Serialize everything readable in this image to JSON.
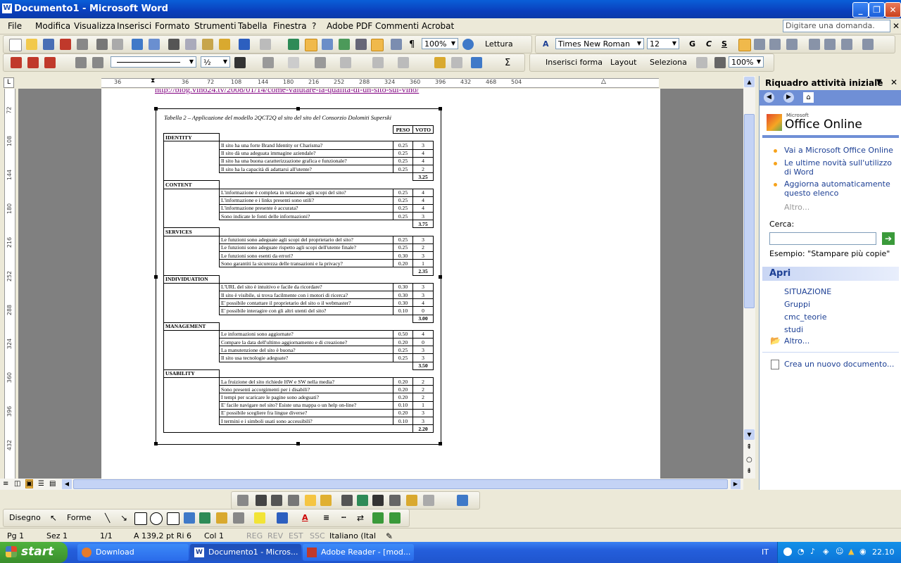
{
  "window": {
    "title": "Documento1 - Microsoft Word",
    "app_icon": "W"
  },
  "menu": {
    "items": [
      "File",
      "Modifica",
      "Visualizza",
      "Inserisci",
      "Formato",
      "Strumenti",
      "Tabella",
      "Finestra",
      "?",
      "Adobe PDF",
      "Commenti Acrobat"
    ],
    "ask_placeholder": "Digitare una domanda."
  },
  "toolbar_standard": {
    "zoom": "100%",
    "reading_label": "Lettura",
    "font": "Times New Roman",
    "size": "12",
    "bold": "G",
    "italic": "C",
    "underline": "S"
  },
  "toolbar_second": {
    "line_weight": "½",
    "insert_shape": "Inserisci forma",
    "layout": "Layout",
    "select": "Seleziona",
    "zoom": "100%"
  },
  "ruler": {
    "marks": [
      "36",
      "36",
      "72",
      "108",
      "144",
      "180",
      "216",
      "252",
      "288",
      "324",
      "360",
      "396",
      "432",
      "468",
      "504"
    ],
    "vmarks": [
      "72",
      "108",
      "144",
      "180",
      "216",
      "252",
      "288",
      "324",
      "360",
      "396",
      "432"
    ]
  },
  "document": {
    "link_text": "http://blog.vino24.tv/2008/01/14/come-valutare-la-qualita-di-un-sito-sul-vino/",
    "table_title": "Tabella 2 – Applicazione del modello 2QCT2Q al sito del sito del Consorzio Dolomiti Superski",
    "headers": {
      "peso": "PESO",
      "voto": "VOTO"
    },
    "sections": [
      {
        "name": "IDENTITY",
        "total": "3.25",
        "rows": [
          {
            "q": "Il sito ha una forte Brand Identity or Charisma?",
            "peso": "0.25",
            "voto": "3"
          },
          {
            "q": "Il sito dà una adeguata immagine aziendale?",
            "peso": "0.25",
            "voto": "4"
          },
          {
            "q": "Il sito ha una buona caratterizzazione grafica e funzionale?",
            "peso": "0.25",
            "voto": "4"
          },
          {
            "q": "Il sito ha la capacità di adattarsi all'utente?",
            "peso": "0.25",
            "voto": "2"
          }
        ]
      },
      {
        "name": "CONTENT",
        "total": "3.75",
        "rows": [
          {
            "q": "L'informazione è completa in relazione agli scopi del sito?",
            "peso": "0.25",
            "voto": "4"
          },
          {
            "q": "L'informazione e i links presenti sono utili?",
            "peso": "0.25",
            "voto": "4"
          },
          {
            "q": "L'informazione presente è accurata?",
            "peso": "0.25",
            "voto": "4"
          },
          {
            "q": "Sono indicate le fonti delle informazioni?",
            "peso": "0.25",
            "voto": "3"
          }
        ]
      },
      {
        "name": "SERVICES",
        "total": "2.35",
        "rows": [
          {
            "q": "Le funzioni sono adeguate agli scopi del proprietario del sito?",
            "peso": "0.25",
            "voto": "3"
          },
          {
            "q": "Le funzioni sono adeguate rispetto agli scopi dell'utente finale?",
            "peso": "0.25",
            "voto": "2"
          },
          {
            "q": "Le funzioni sono esenti da errori?",
            "peso": "0.30",
            "voto": "3"
          },
          {
            "q": "Sono garantiti la sicurezza delle transazioni e la privacy?",
            "peso": "0.20",
            "voto": "1"
          }
        ]
      },
      {
        "name": "INDIVIDUATION",
        "total": "3.00",
        "rows": [
          {
            "q": "L'URL del sito è intuitivo e facile da ricordare?",
            "peso": "0.30",
            "voto": "3"
          },
          {
            "q": "Il sito è visibile, si trova facilmente con i motori di ricerca?",
            "peso": "0.30",
            "voto": "3"
          },
          {
            "q": "E' possibile contattare il proprietario del sito o il webmaster?",
            "peso": "0.30",
            "voto": "4"
          },
          {
            "q": "E' possibile interagire con gli altri utenti del sito?",
            "peso": "0.10",
            "voto": "0"
          }
        ]
      },
      {
        "name": "MANAGEMENT",
        "total": "3.50",
        "rows": [
          {
            "q": "Le informazioni sono aggiornate?",
            "peso": "0.50",
            "voto": "4"
          },
          {
            "q": "Compare la data dell'ultimo aggiornamento e di creazione?",
            "peso": "0.20",
            "voto": "0"
          },
          {
            "q": "La manutenzione del sito è buona?",
            "peso": "0.25",
            "voto": "3"
          },
          {
            "q": "Il sito usa tecnologie adeguate?",
            "peso": "0.25",
            "voto": "3"
          }
        ]
      },
      {
        "name": "USABILITY",
        "total": "2.20",
        "rows": [
          {
            "q": "La fruizione del sito richiede HW e SW nella media?",
            "peso": "0.20",
            "voto": "2"
          },
          {
            "q": "Sono presenti accorgimenti per i disabili?",
            "peso": "0.20",
            "voto": "2"
          },
          {
            "q": "I tempi per scaricare le pagine sono adeguati?",
            "peso": "0.20",
            "voto": "2"
          },
          {
            "q": "E' facile navigare nel sito? Esiste una mappa o un help on-line?",
            "peso": "0.10",
            "voto": "1"
          },
          {
            "q": "E' possibile scegliere fra lingue diverse?",
            "peso": "0.20",
            "voto": "3"
          },
          {
            "q": "I termini e i simboli usati sono accessibili?",
            "peso": "0.10",
            "voto": "3"
          }
        ]
      }
    ]
  },
  "taskpane": {
    "title": "Riquadro attività iniziale",
    "logo_small": "Microsoft",
    "logo": "Office Online",
    "links": [
      "Vai a Microsoft Office Online",
      "Le ultime novità sull'utilizzo di Word",
      "Aggiorna automaticamente questo elenco"
    ],
    "more": "Altro...",
    "search_label": "Cerca:",
    "example": "Esempio:  \"Stampare più copie\"",
    "open_title": "Apri",
    "recent": [
      "SITUAZIONE",
      "Gruppi",
      "cmc_teorie",
      "studi"
    ],
    "open_more": "Altro...",
    "new_doc": "Crea un nuovo documento..."
  },
  "drawbar": {
    "draw": "Disegno",
    "shapes": "Forme"
  },
  "status": {
    "page": "Pg 1",
    "section": "Sez 1",
    "pages": "1/1",
    "position": "A 139,2 pt Ri  6",
    "col": "Col 1",
    "rec": "REG",
    "rev": "REV",
    "ext": "EST",
    "ovr": "SSC",
    "lang": "Italiano (Ital"
  },
  "taskbar": {
    "start": "start",
    "buttons": [
      "Download",
      "Documento1 - Micros...",
      "Adobe Reader - [mod..."
    ],
    "lang": "IT",
    "clock": "22.10"
  }
}
